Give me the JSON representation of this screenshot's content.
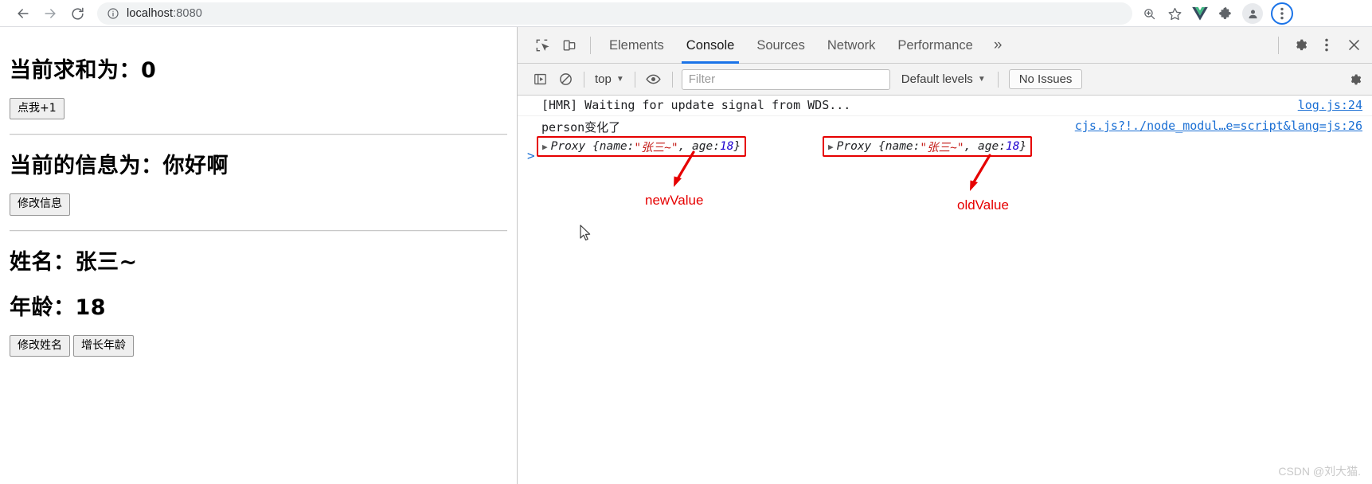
{
  "browser": {
    "back_icon": "arrow-left-icon",
    "forward_icon": "arrow-right-icon",
    "reload_icon": "reload-icon",
    "site_info_icon": "info-circle-icon",
    "url_host": "localhost",
    "url_port": ":8080",
    "zoom_icon": "zoom-in-icon",
    "bookmark_icon": "star-icon",
    "vue_devtools_icon": "vue-logo-icon",
    "extensions_icon": "puzzle-piece-icon",
    "profile_icon": "person-avatar-icon",
    "menu_icon": "three-dot-menu-icon"
  },
  "page": {
    "sum_label": "当前求和为：",
    "sum_value": "0",
    "sum_button": "点我+1",
    "msg_label": "当前的信息为：",
    "msg_value": "你好啊",
    "msg_button": "修改信息",
    "name_label": "姓名：",
    "name_value": "张三~",
    "age_label": "年龄：",
    "age_value": "18",
    "name_button": "修改姓名",
    "age_button": "增长年龄"
  },
  "devtools": {
    "inspect_icon": "inspect-element-icon",
    "device_icon": "device-toolbar-icon",
    "tabs": [
      {
        "label": "Elements",
        "active": false
      },
      {
        "label": "Console",
        "active": true
      },
      {
        "label": "Sources",
        "active": false
      },
      {
        "label": "Network",
        "active": false
      },
      {
        "label": "Performance",
        "active": false
      }
    ],
    "more_tabs": "»",
    "settings_icon": "gear-icon",
    "kebab_icon": "three-dot-menu-icon",
    "close_icon": "close-x-icon",
    "toolbar": {
      "sidebar_icon": "console-sidebar-icon",
      "clear_icon": "clear-console-icon",
      "context": "top",
      "eye_icon": "live-expression-eye-icon",
      "filter_placeholder": "Filter",
      "levels": "Default levels",
      "issues": "No Issues",
      "settings_icon": "gear-icon"
    },
    "console": {
      "rows": [
        {
          "text": "[HMR] Waiting for update signal from WDS...",
          "source": "log.js:24"
        },
        {
          "text": "person变化了",
          "source": "cjs.js?!./node_modul…e=script&lang=js:26"
        }
      ],
      "proxy_new": {
        "triangle": "▶",
        "prefix": "Proxy {name: ",
        "name": "\"张三~\"",
        "mid": ", age: ",
        "age": "18",
        "suffix": "}"
      },
      "proxy_old": {
        "triangle": "▶",
        "prefix": "Proxy {name: ",
        "name": "\"张三~\"",
        "mid": ", age: ",
        "age": "18",
        "suffix": "}"
      },
      "prompt": ">",
      "annotation_new": "newValue",
      "annotation_old": "oldValue"
    }
  },
  "watermark": "CSDN @刘大猫.",
  "colors": {
    "accent_blue": "#1a73e8",
    "annotation_red": "#e60000",
    "string_red": "#c41a16",
    "number_blue": "#1c00cf",
    "link_blue": "#1a6fd4"
  }
}
